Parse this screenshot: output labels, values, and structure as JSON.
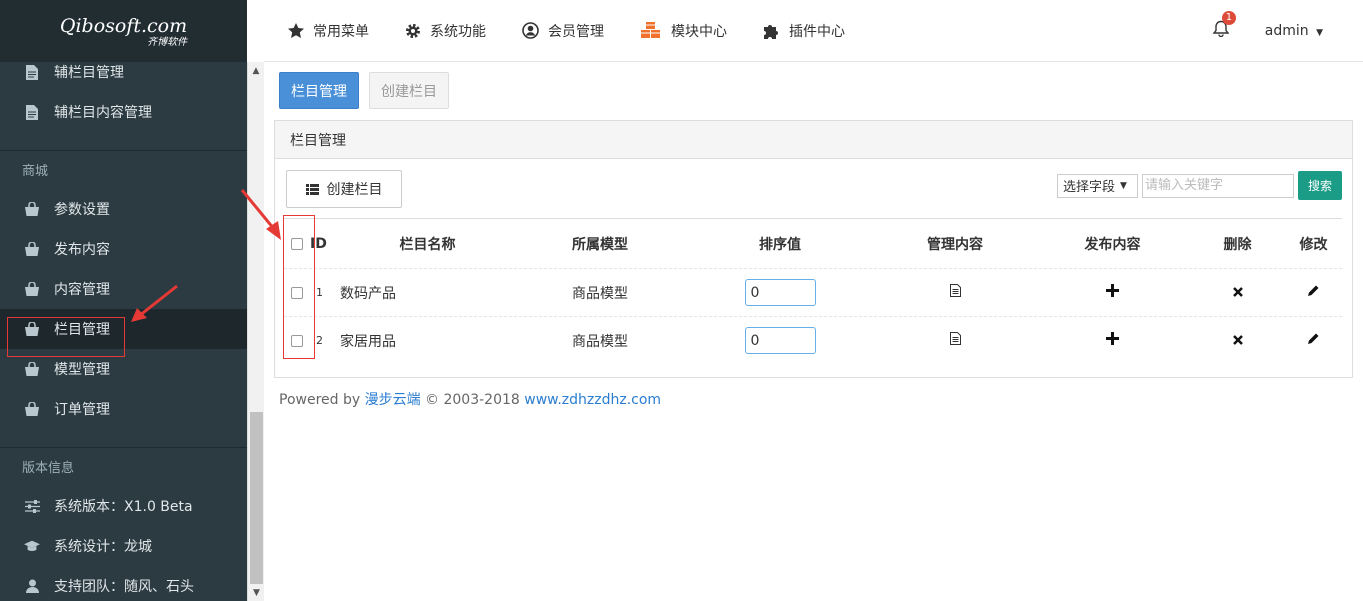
{
  "logo": {
    "text": "Qibosoft.com",
    "sub": "齐博软件"
  },
  "sidebar": {
    "items_top": [
      {
        "label": "辅栏目管理",
        "icon": "document-icon"
      },
      {
        "label": "辅栏目内容管理",
        "icon": "document-icon"
      }
    ],
    "section_mall": "商城",
    "items_mall": [
      {
        "label": "参数设置",
        "icon": "bag-icon"
      },
      {
        "label": "发布内容",
        "icon": "bag-icon"
      },
      {
        "label": "内容管理",
        "icon": "bag-icon"
      },
      {
        "label": "栏目管理",
        "icon": "bag-icon",
        "active": true
      },
      {
        "label": "模型管理",
        "icon": "bag-icon"
      },
      {
        "label": "订单管理",
        "icon": "bag-icon"
      }
    ],
    "section_version": "版本信息",
    "items_version": [
      {
        "label": "系统版本：X1.0 Beta",
        "icon": "sliders-icon"
      },
      {
        "label": "系统设计：龙城",
        "icon": "graduation-cap-icon"
      },
      {
        "label": "支持团队：随风、石头",
        "icon": "user-icon"
      }
    ]
  },
  "topnav": {
    "items": [
      {
        "label": "常用菜单",
        "icon": "star-icon"
      },
      {
        "label": "系统功能",
        "icon": "gear-icon"
      },
      {
        "label": "会员管理",
        "icon": "user-circle-icon"
      },
      {
        "label": "模块中心",
        "icon": "cubes-icon"
      },
      {
        "label": "插件中心",
        "icon": "puzzle-icon"
      }
    ],
    "notification_count": "1",
    "user": "admin"
  },
  "tabs": {
    "active": "栏目管理",
    "inactive": "创建栏目"
  },
  "panel": {
    "title": "栏目管理",
    "create_button": "创建栏目",
    "select_field": "选择字段",
    "keyword_placeholder": "请输入关键字",
    "search_button": "搜索"
  },
  "table": {
    "headers": {
      "id": "ID",
      "name": "栏目名称",
      "model": "所属模型",
      "sort": "排序值",
      "manage": "管理内容",
      "publish": "发布内容",
      "delete": "删除",
      "edit": "修改"
    },
    "rows": [
      {
        "id": "1",
        "name": "数码产品",
        "model": "商品模型",
        "sort": "0"
      },
      {
        "id": "2",
        "name": "家居用品",
        "model": "商品模型",
        "sort": "0"
      }
    ]
  },
  "footer": {
    "prefix": "Powered by ",
    "brand": "漫步云端",
    "copyright": " © 2003-2018 ",
    "site": "www.zdhzzdhz.com"
  }
}
